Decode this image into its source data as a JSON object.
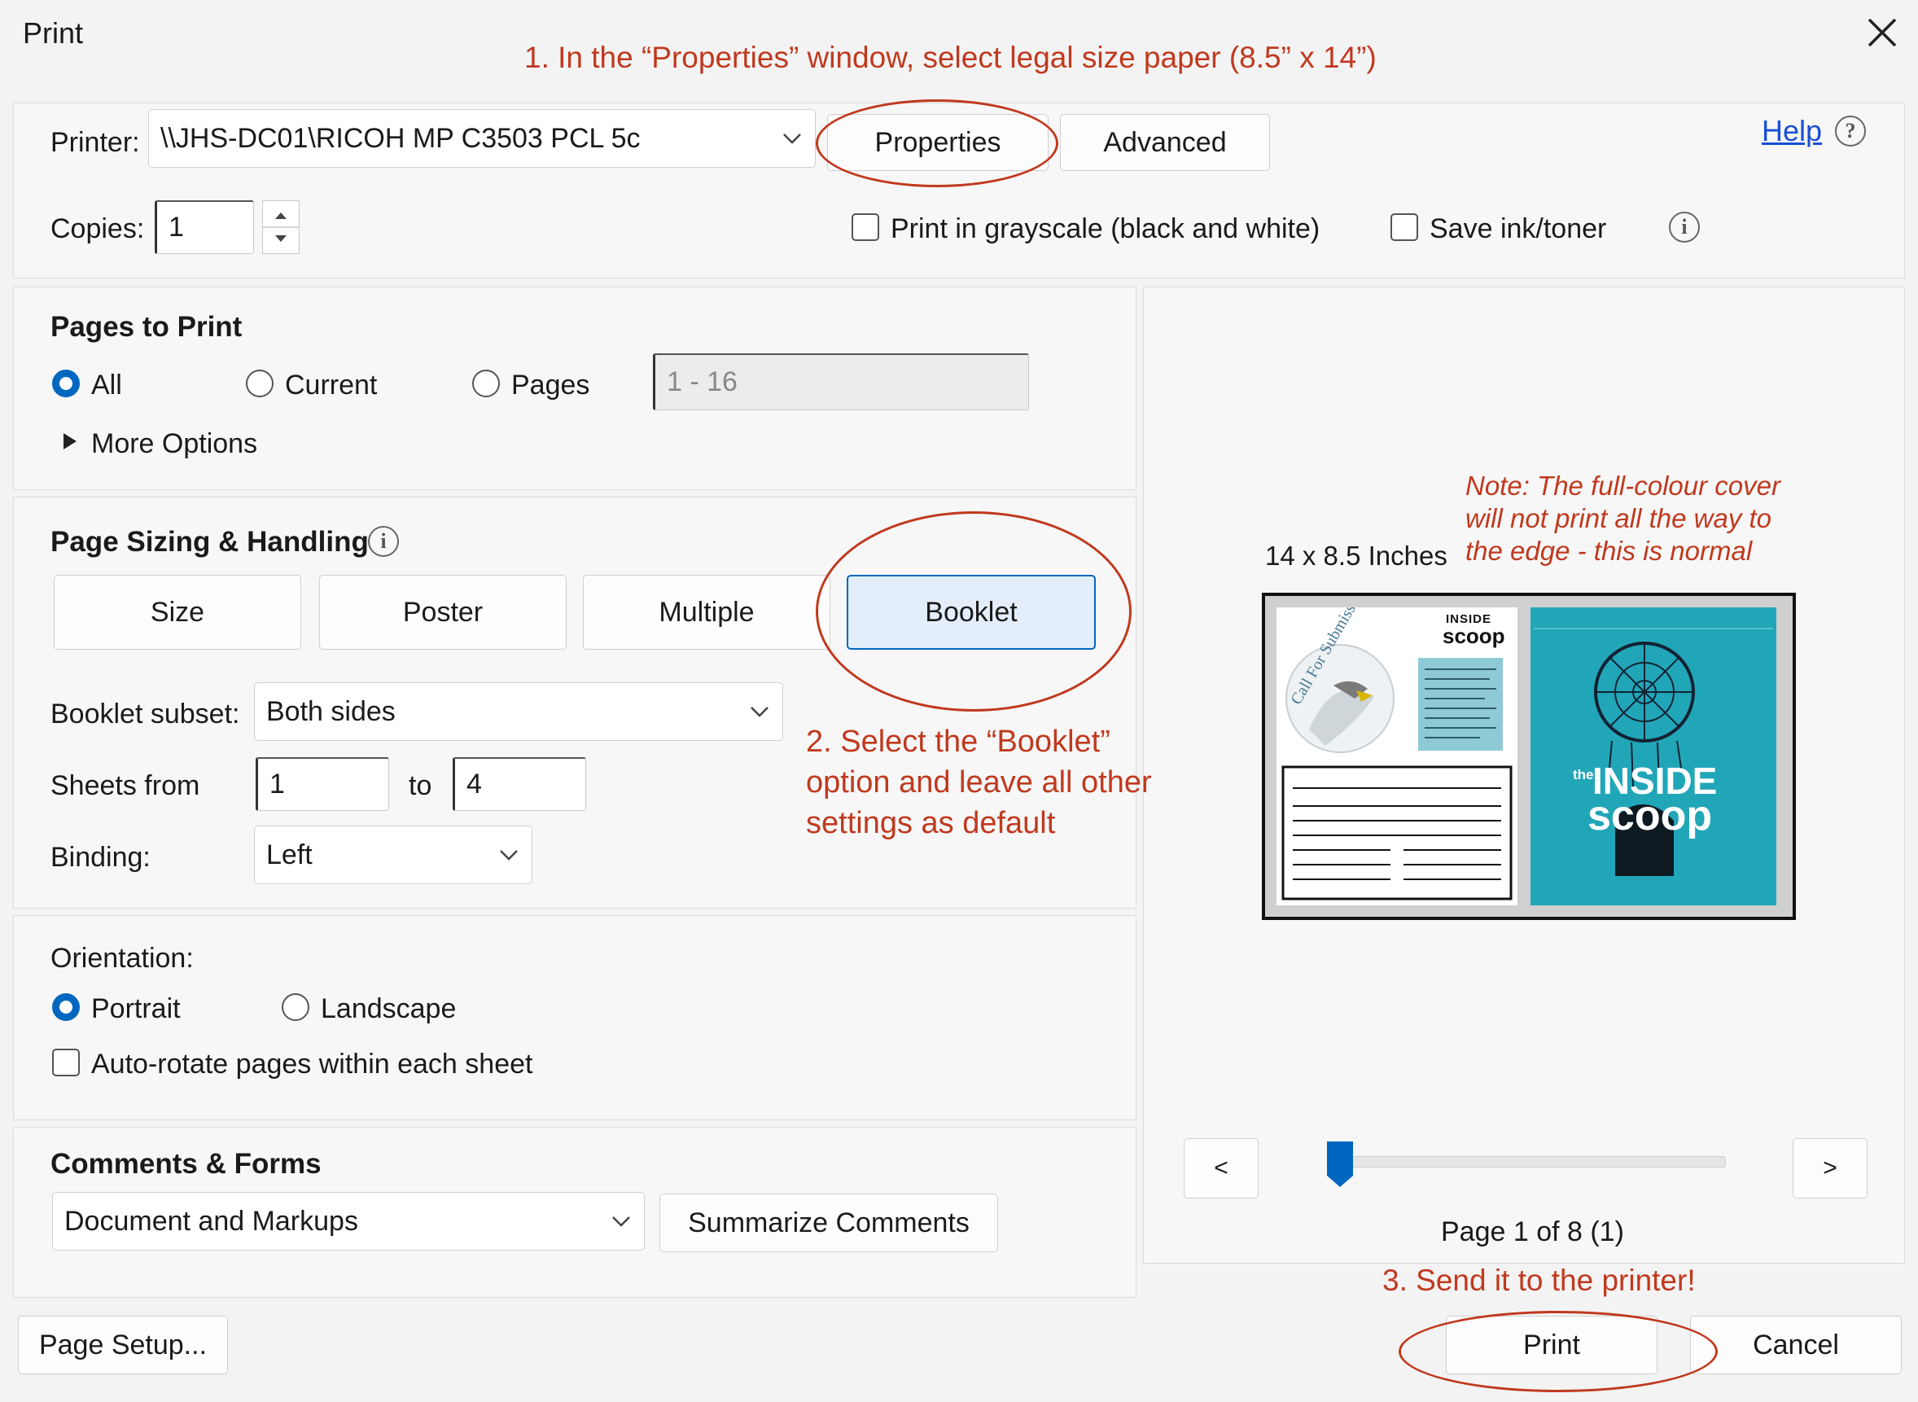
{
  "window": {
    "title": "Print",
    "close_glyph": "✕"
  },
  "annotations": {
    "step1": "1. In the “Properties” window, select legal size paper (8.5” x 14”)",
    "step2_line1": "2. Select the “Booklet”",
    "step2_line2": "option and leave all other",
    "step2_line3": "settings as default",
    "step3": "3. Send it to the printer!",
    "note_line1": "Note: The full-colour cover",
    "note_line2": "will not print all the way to",
    "note_line3": "the edge - this is normal"
  },
  "printer": {
    "label": "Printer:",
    "value": "\\\\JHS-DC01\\RICOH MP C3503 PCL 5c",
    "properties_label": "Properties",
    "advanced_label": "Advanced",
    "help_label": "Help",
    "help_glyph": "?"
  },
  "copies": {
    "label": "Copies:",
    "value": "1",
    "grayscale_label": "Print in grayscale (black and white)",
    "save_ink_label": "Save ink/toner",
    "info_glyph": "i"
  },
  "pages_to_print": {
    "heading": "Pages to Print",
    "all_label": "All",
    "current_label": "Current",
    "pages_label": "Pages",
    "pages_range_placeholder": "1 - 16",
    "more_options_label": "More Options"
  },
  "sizing": {
    "heading": "Page Sizing & Handling",
    "info_glyph": "i",
    "size_label": "Size",
    "poster_label": "Poster",
    "multiple_label": "Multiple",
    "booklet_label": "Booklet",
    "booklet_subset_label": "Booklet subset:",
    "booklet_subset_value": "Both sides",
    "sheets_from_label": "Sheets from",
    "sheets_from_value": "1",
    "to_label": "to",
    "sheets_to_value": "4",
    "binding_label": "Binding:",
    "binding_value": "Left"
  },
  "orientation": {
    "heading": "Orientation:",
    "portrait_label": "Portrait",
    "landscape_label": "Landscape",
    "autorotate_label": "Auto-rotate pages within each sheet"
  },
  "comments": {
    "heading": "Comments & Forms",
    "value": "Document and Markups",
    "summarize_label": "Summarize Comments"
  },
  "preview": {
    "size_label": "14 x 8.5 Inches",
    "prev_glyph": "<",
    "next_glyph": ">",
    "page_indicator": "Page 1 of 8 (1)",
    "slider_fraction": 0.0,
    "cover_title_top": "the",
    "cover_title_mid": "INSIDE",
    "cover_title_bottom": "scoop",
    "back_logo_top": "INSIDE",
    "back_logo_bottom": "scoop"
  },
  "footer": {
    "page_setup_label": "Page Setup...",
    "print_label": "Print",
    "cancel_label": "Cancel"
  },
  "colors": {
    "accent": "#0067c0",
    "annotation": "#c0391e",
    "link": "#1a4fd6",
    "cover_teal": "#21a6b8",
    "booklet_selected_bg": "#e3eefa"
  }
}
